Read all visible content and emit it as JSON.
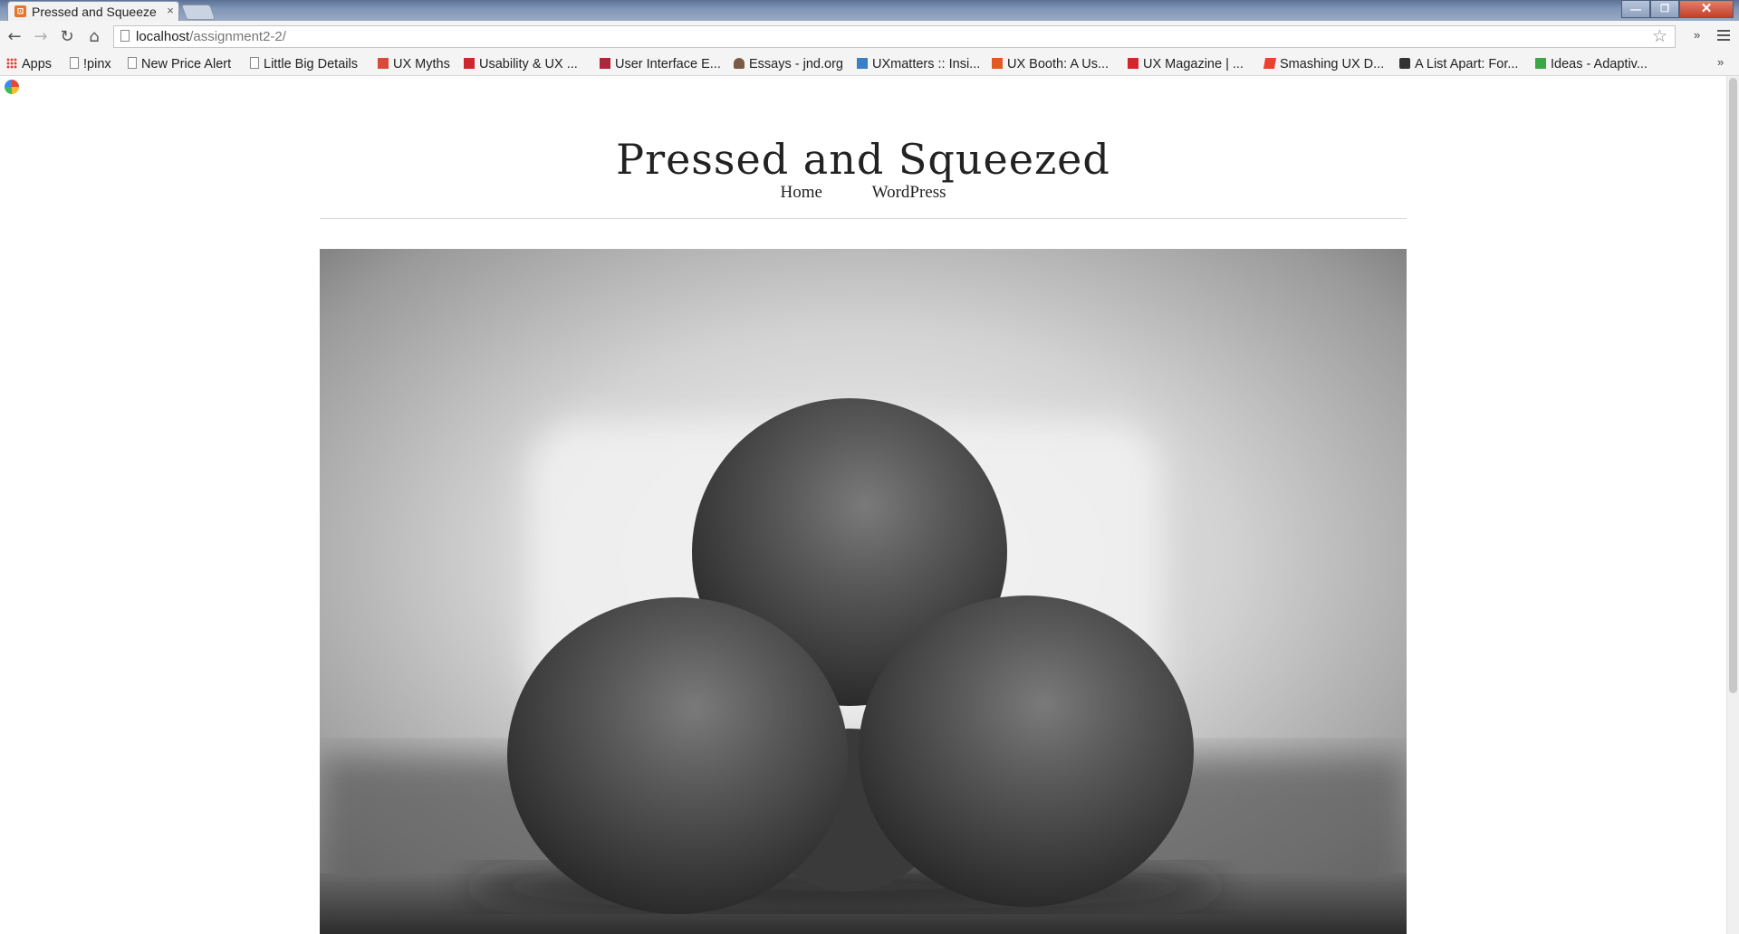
{
  "browser": {
    "tab_title": "Pressed and Squeeze",
    "tab_close": "×",
    "url_host": "localhost",
    "url_path": "/assignment2-2/",
    "window_min": "—",
    "window_max": "❐",
    "window_close": "✕"
  },
  "bookmarks": {
    "items": [
      "Apps",
      "!pinx",
      "New Price Alert",
      "Little Big Details",
      "UX Myths",
      "Usability & UX ...",
      "User Interface E...",
      "Essays - jnd.org",
      "UXmatters :: Insi...",
      "UX Booth: A Us...",
      "UX Magazine | ...",
      "Smashing UX D...",
      "A List Apart: For...",
      "Ideas - Adaptiv..."
    ],
    "more": "»"
  },
  "site": {
    "title": "Pressed and Squeezed",
    "nav": [
      "Home",
      "WordPress"
    ]
  },
  "featured_image": {
    "subject": "three oranges stacked in a pyramid, black and white photo"
  }
}
